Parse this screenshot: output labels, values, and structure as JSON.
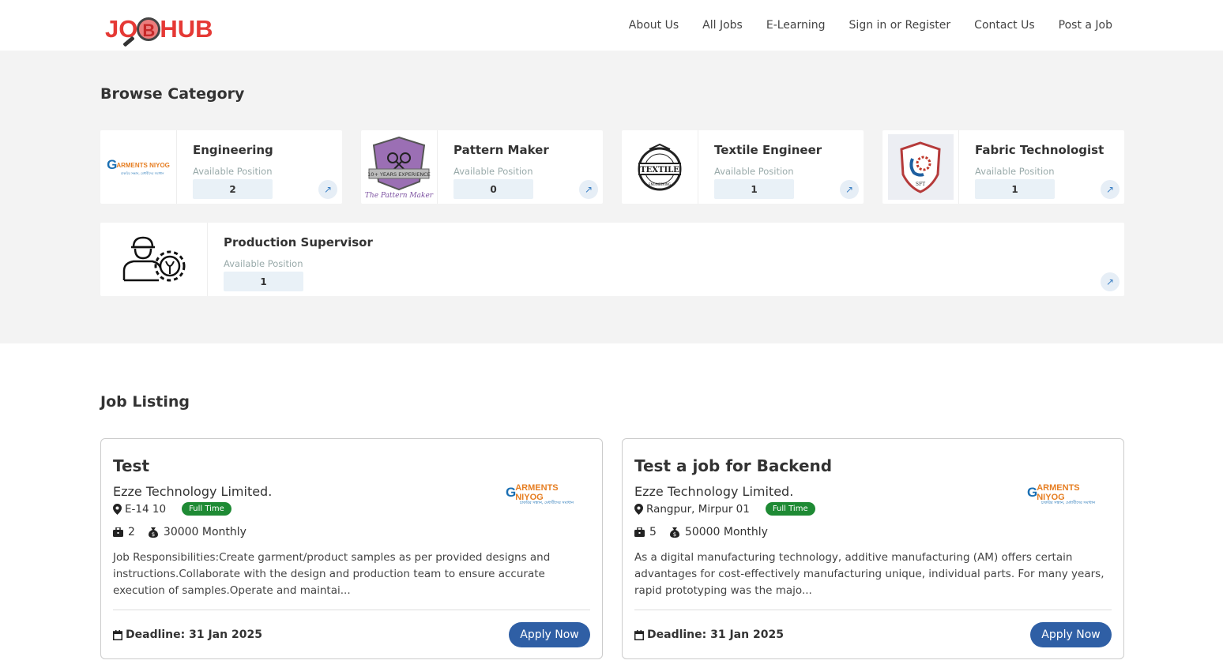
{
  "header": {
    "logo_text_left": "JO",
    "logo_lens_letter": "B",
    "logo_text_right": "HUB",
    "nav": [
      "About Us",
      "All Jobs",
      "E-Learning",
      "Sign in or Register",
      "Contact Us",
      "Post a Job"
    ]
  },
  "browse": {
    "title": "Browse Category",
    "available_label": "Available Position",
    "categories": [
      {
        "name": "Engineering",
        "count": "2",
        "logo": "garments-niyog-logo"
      },
      {
        "name": "Pattern Maker",
        "count": "0",
        "logo": "pattern-maker-logo"
      },
      {
        "name": "Textile Engineer",
        "count": "1",
        "logo": "textile-badge-logo"
      },
      {
        "name": "Fabric Technologist",
        "count": "1",
        "logo": "sft-shield-logo"
      },
      {
        "name": "Production Supervisor",
        "count": "1",
        "logo": "worker-gear-icon"
      }
    ]
  },
  "logos": {
    "garments_niyog": {
      "g": "G",
      "text": "ARMENTS NIYOG",
      "sub": "চাকরির সন্ধান, মেধাবীদের সমাধান"
    },
    "pattern_maker": {
      "ribbon": "10+ YEARS EXPERIENCE",
      "caption": "The Pattern Maker"
    },
    "textile": {
      "label": "TEXTILE",
      "ring": "ENGINEERING"
    },
    "sft": {
      "label": "SFT"
    }
  },
  "jobs": {
    "title": "Job Listing",
    "apply_label": "Apply Now",
    "listings": [
      {
        "title": "Test",
        "company": "Ezze Technology Limited.",
        "location": "E-14 10",
        "type": "Full Time",
        "vacancies": "2",
        "salary": "30000 Monthly",
        "description": "Job Responsibilities:Create garment/product samples as per provided designs and instructions.Collaborate with the design and production team to ensure accurate execution of samples.Operate and maintai...",
        "deadline": "Deadline: 31 Jan 2025"
      },
      {
        "title": "Test a job for Backend",
        "company": "Ezze Technology Limited.",
        "location": "Rangpur, Mirpur 01",
        "type": "Full Time",
        "vacancies": "5",
        "salary": "50000 Monthly",
        "description": "As a digital manufacturing technology, additive manufacturing (AM) offers certain advantages for cost-effectively manufacturing unique, individual parts. For many years, rapid prototyping was the majo...",
        "deadline": "Deadline: 31 Jan 2025"
      }
    ]
  },
  "colors": {
    "brand_red": "#e53935",
    "apply_blue": "#2f5fa5",
    "fulltime_green": "#1e8a34",
    "browse_bg": "#f3f3f3"
  }
}
